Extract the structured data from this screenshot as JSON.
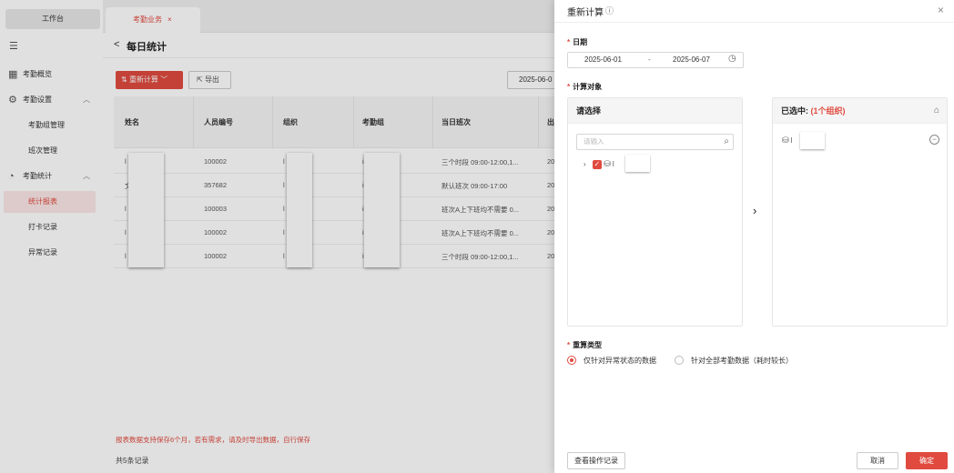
{
  "sidebar": {
    "workbench_tab": "工作台",
    "menu_toggle_icon": "menu-collapse-icon",
    "items": [
      {
        "label": "考勤概览",
        "icon": "grid-icon"
      },
      {
        "label": "考勤设置",
        "icon": "settings-icon"
      },
      {
        "label": "考勤组管理"
      },
      {
        "label": "班次管理"
      },
      {
        "label": "考勤统计",
        "icon": "pie-chart-icon"
      },
      {
        "label": "统计报表",
        "active": true
      },
      {
        "label": "打卡记录"
      },
      {
        "label": "异常记录"
      }
    ]
  },
  "top_tabs": [
    {
      "label": "考勤业务",
      "close": "×"
    }
  ],
  "page": {
    "back_glyph": "<",
    "title": "每日统计",
    "recalc_button": "重新计算",
    "export_button": "导出",
    "date_partial": "2025-06-0"
  },
  "table": {
    "headers": [
      "姓名",
      "人员编号",
      "组织",
      "考勤组",
      "当日班次",
      "出"
    ],
    "rows": [
      {
        "name": "l",
        "id": "100002",
        "org": "l",
        "group": "i",
        "shift": "三个时段 09:00-12:00,1...",
        "out": "20"
      },
      {
        "name": "文",
        "id": "357682",
        "org": "l",
        "group": "i",
        "shift": "默认班次 09:00-17:00",
        "out": "20"
      },
      {
        "name": "l",
        "id": "100003",
        "org": "l",
        "group": "i",
        "shift": "班次A上下班均不需要 0...",
        "out": "20"
      },
      {
        "name": "l",
        "id": "100002",
        "org": "l",
        "group": "i",
        "shift": "班次A上下班均不需要 0...",
        "out": "20"
      },
      {
        "name": "l",
        "id": "100002",
        "org": "l",
        "group": "i",
        "shift": "三个时段 09:00-12:00,1...",
        "out": "20"
      }
    ]
  },
  "footer": {
    "note": "报表数据支持保存6个月，若有需求，请及时导出数据，自行保存",
    "count": "共5条记录"
  },
  "drawer": {
    "title": "重新计算",
    "date_label": "日期",
    "date_start": "2025-06-01",
    "date_sep": "-",
    "date_end": "2025-06-07",
    "target_label": "计算对象",
    "left_panel_title": "请选择",
    "search_placeholder": "请输入",
    "tree_item_text": "l",
    "right_panel_title": "已选中:",
    "right_panel_count": "(1个组织)",
    "selected_item_text": "l",
    "recalc_type_label": "重算类型",
    "option_abnormal": "仅针对异常状态的数据",
    "option_all": "针对全部考勤数据（耗时较长）",
    "selected_option": "abnormal",
    "view_log_button": "查看操作记录",
    "cancel_button": "取消",
    "confirm_button": "确定"
  },
  "colors": {
    "accent": "#e04a3f",
    "active_bg": "#fbe7e6"
  }
}
